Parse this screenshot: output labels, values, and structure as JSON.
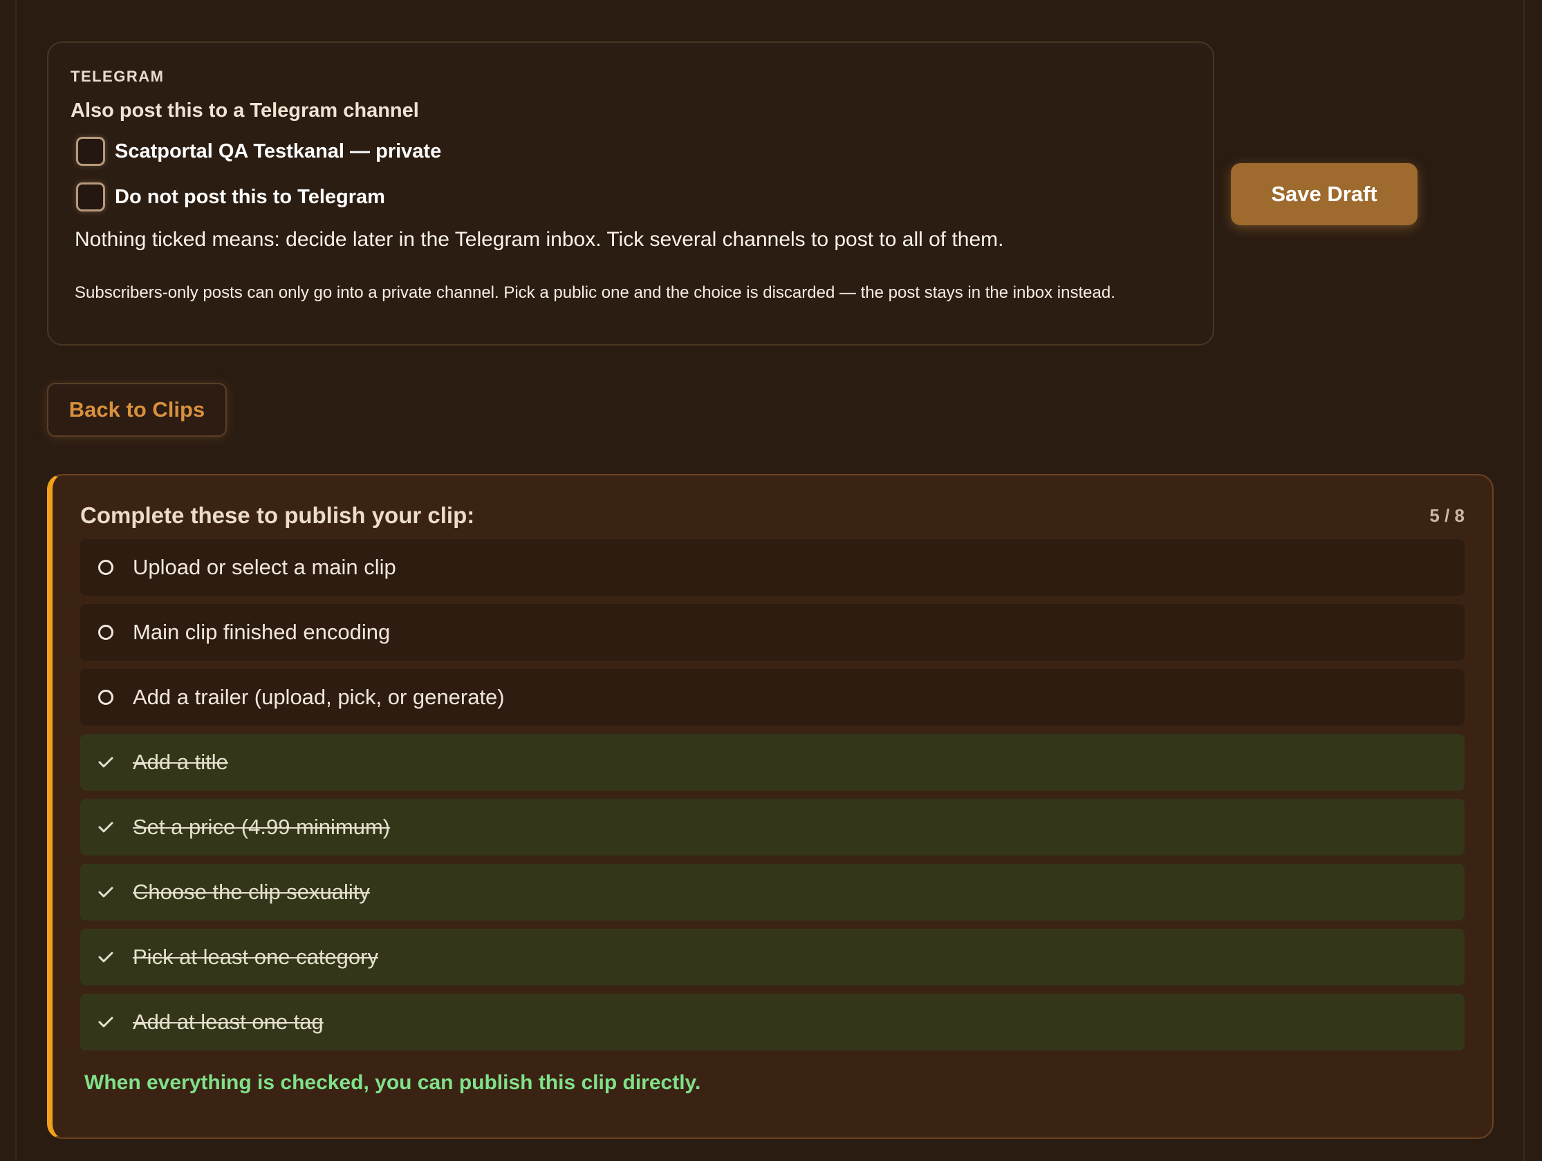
{
  "telegram": {
    "eyebrow": "TELEGRAM",
    "heading": "Also post this to a Telegram channel",
    "options": [
      {
        "label": "Scatportal QA Testkanal — private",
        "checked": false
      },
      {
        "label": "Do not post this to Telegram",
        "checked": false
      }
    ],
    "help": "Nothing ticked means: decide later in the Telegram inbox. Tick several channels to post to all of them.",
    "note": "Subscribers-only posts can only go into a private channel. Pick a public one and the choice is discarded — the post stays in the inbox instead."
  },
  "actions": {
    "save_draft": "Save Draft",
    "back": "Back to Clips"
  },
  "checklist": {
    "title": "Complete these to publish your clip:",
    "count": "5 / 8",
    "items": [
      {
        "label": "Upload or select a main clip",
        "done": false
      },
      {
        "label": "Main clip finished encoding",
        "done": false
      },
      {
        "label": "Add a trailer (upload, pick, or generate)",
        "done": false
      },
      {
        "label": "Add a title",
        "done": true
      },
      {
        "label": "Set a price (4.99 minimum)",
        "done": true
      },
      {
        "label": "Choose the clip sexuality",
        "done": true
      },
      {
        "label": "Pick at least one category",
        "done": true
      },
      {
        "label": "Add at least one tag",
        "done": true
      }
    ],
    "footer": "When everything is checked, you can publish this clip directly."
  },
  "colors": {
    "background": "#2b1c12",
    "accent": "#f0a11a",
    "primary_button": "#9e6a2e",
    "success_text": "#7fe28a"
  }
}
